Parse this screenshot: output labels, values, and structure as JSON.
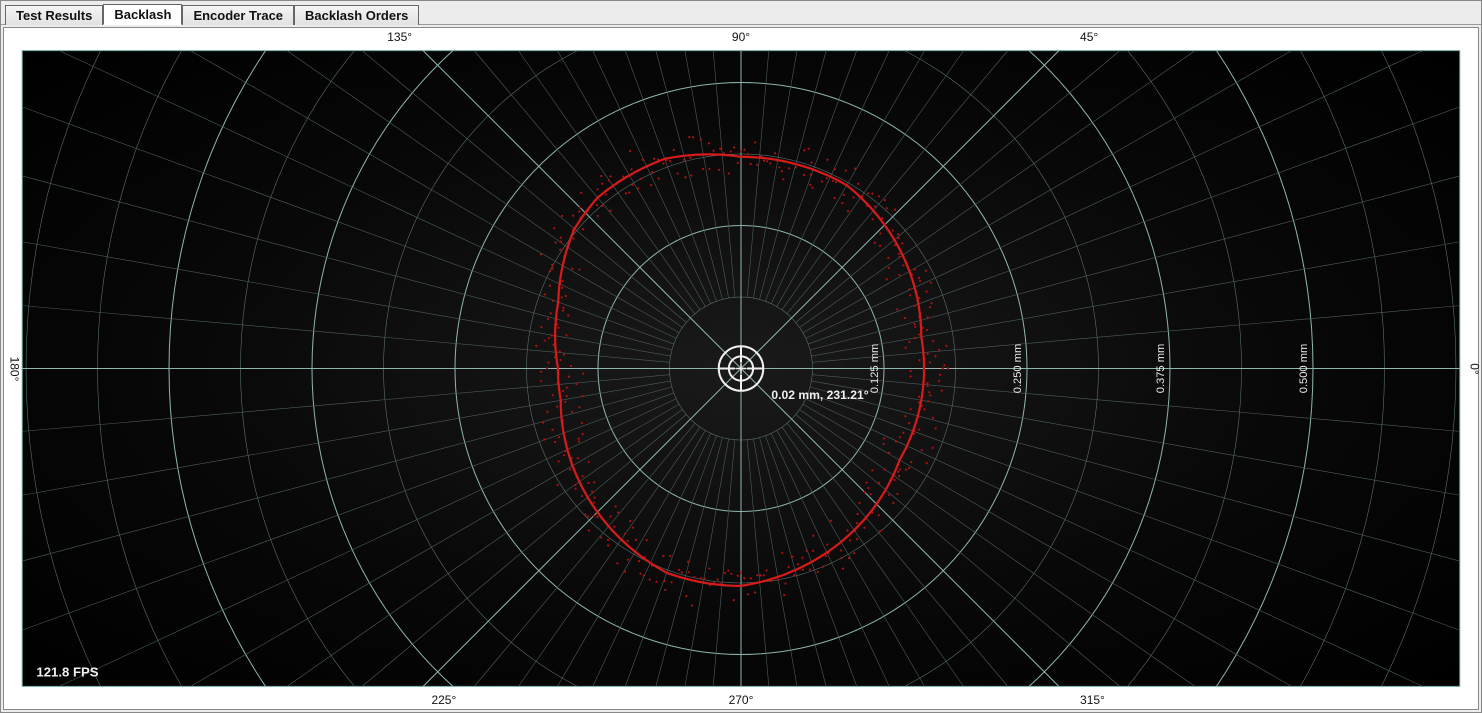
{
  "tabs": [
    {
      "label": "Test Results",
      "active": false
    },
    {
      "label": "Backlash",
      "active": true
    },
    {
      "label": "Encoder Trace",
      "active": false
    },
    {
      "label": "Backlash Orders",
      "active": false
    }
  ],
  "fps": "121.8 FPS",
  "cursor_readout": "0.02 mm, 231.21°",
  "angle_labels": {
    "top_left": "135°",
    "top_mid": "90°",
    "top_right": "45°",
    "right": "0°",
    "bottom_right": "315°",
    "bottom_mid": "270°",
    "bottom_left": "225°",
    "left": "180°"
  },
  "ring_labels": [
    "0.125 mm",
    "0.250 mm",
    "0.375 mm",
    "0.500 mm"
  ],
  "colors": {
    "bg": "#050505",
    "grid": "#9bbcb8",
    "grid_faint": "#555",
    "trace": "#d71b1b",
    "points": "#b01010",
    "fg": "#f2f2f2"
  },
  "chart_data": {
    "type": "polar",
    "title": "Backlash",
    "r_unit": "mm",
    "r_range": [
      0,
      0.625
    ],
    "r_ticks": [
      0.125,
      0.25,
      0.375,
      0.5
    ],
    "angle_unit": "deg",
    "angle_ticks_deg": [
      0,
      45,
      90,
      135,
      180,
      225,
      270,
      315
    ],
    "smooth_curve_r_by_angle_deg": {
      "0": 0.16,
      "10": 0.16,
      "20": 0.165,
      "30": 0.17,
      "40": 0.175,
      "50": 0.18,
      "60": 0.185,
      "70": 0.185,
      "80": 0.185,
      "90": 0.185,
      "100": 0.19,
      "110": 0.195,
      "120": 0.195,
      "130": 0.195,
      "140": 0.19,
      "150": 0.18,
      "160": 0.17,
      "170": 0.165,
      "180": 0.16,
      "190": 0.16,
      "200": 0.165,
      "210": 0.17,
      "220": 0.175,
      "230": 0.18,
      "240": 0.185,
      "250": 0.19,
      "260": 0.19,
      "270": 0.19,
      "280": 0.185,
      "290": 0.18,
      "300": 0.175,
      "310": 0.17,
      "320": 0.165,
      "330": 0.16,
      "340": 0.16,
      "350": 0.16
    },
    "scatter_noise_amplitude_mm": 0.015,
    "annotations": {
      "cursor": {
        "r_mm": 0.02,
        "angle_deg": 231.21
      }
    }
  }
}
